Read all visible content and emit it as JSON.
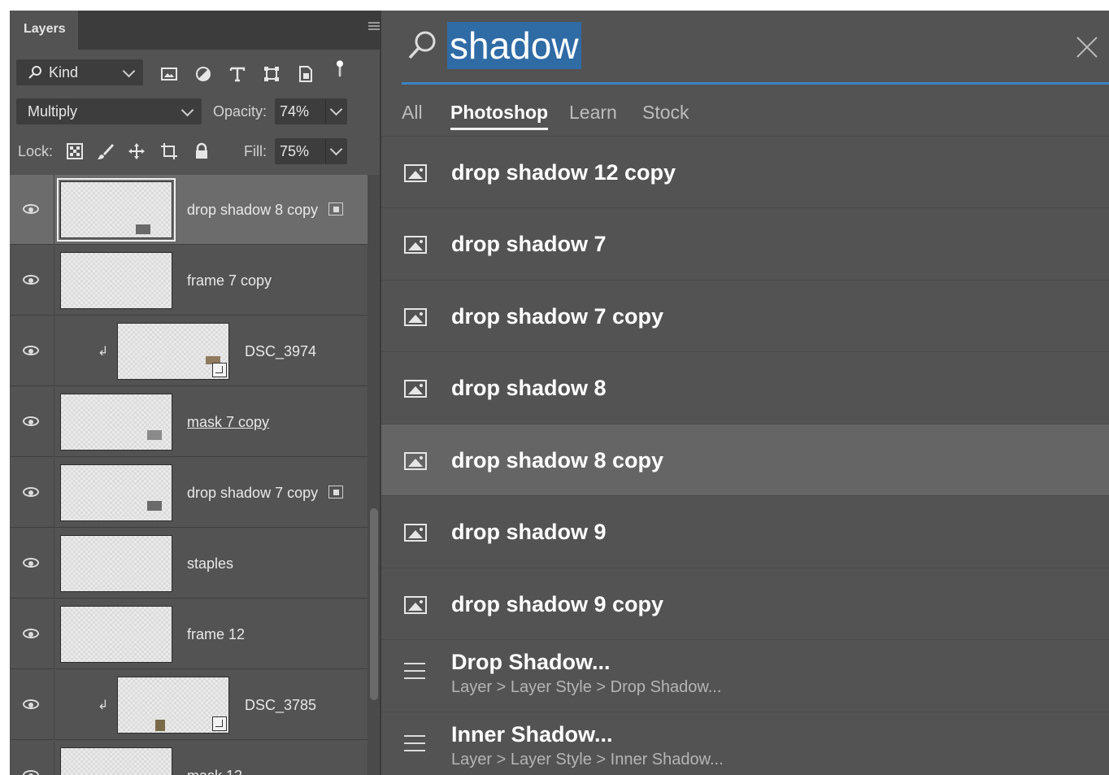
{
  "layers_panel": {
    "title": "Layers",
    "filter": {
      "kind_label": "Kind"
    },
    "blend_mode": "Multiply",
    "opacity_label": "Opacity:",
    "opacity_value": "74%",
    "lock_label": "Lock:",
    "fill_label": "Fill:",
    "fill_value": "75%",
    "layers": [
      {
        "name": "drop shadow 8 copy",
        "selected": true,
        "has_effects_badge": true
      },
      {
        "name": "frame 7 copy"
      },
      {
        "name": "DSC_3974",
        "clipped": true,
        "smart_object": true
      },
      {
        "name": "mask 7 copy",
        "underlined": true
      },
      {
        "name": "drop shadow 7 copy",
        "has_effects_badge": true
      },
      {
        "name": "staples"
      },
      {
        "name": "frame 12"
      },
      {
        "name": "DSC_3785",
        "clipped": true,
        "smart_object": true
      },
      {
        "name": "mask 12"
      }
    ]
  },
  "search_panel": {
    "query": "shadow",
    "tabs": [
      {
        "label": "All",
        "active": false
      },
      {
        "label": "Photoshop",
        "active": true
      },
      {
        "label": "Learn",
        "active": false
      },
      {
        "label": "Stock",
        "active": false
      }
    ],
    "layer_results": [
      {
        "title": "drop shadow 12 copy"
      },
      {
        "title": "drop shadow 7"
      },
      {
        "title": "drop shadow 7 copy"
      },
      {
        "title": "drop shadow 8"
      },
      {
        "title": "drop shadow 8 copy",
        "highlighted": true
      },
      {
        "title": "drop shadow 9"
      },
      {
        "title": "drop shadow 9 copy"
      }
    ],
    "menu_results": [
      {
        "title": "Drop Shadow...",
        "path": "Layer > Layer Style > Drop Shadow..."
      },
      {
        "title": "Inner Shadow...",
        "path": "Layer > Layer Style > Inner Shadow..."
      }
    ]
  },
  "colors": {
    "accent": "#3b82c4",
    "panel_bg": "#535353",
    "selection": "#2f6ba5"
  }
}
